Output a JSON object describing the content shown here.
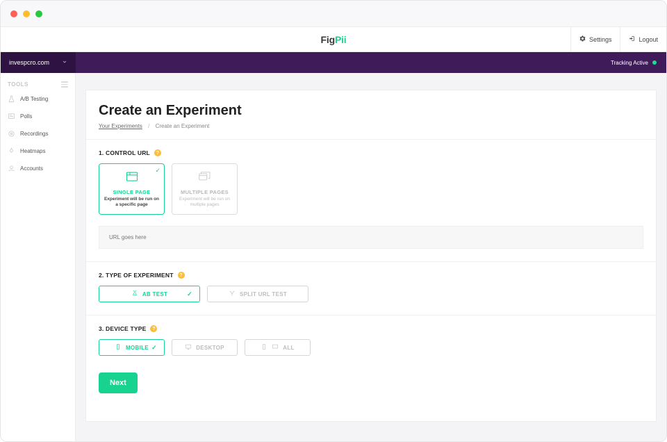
{
  "logo": {
    "part1": "Fig",
    "part2": "Pii"
  },
  "header": {
    "settings": "Settings",
    "logout": "Logout"
  },
  "subbar": {
    "project": "invespcro.com",
    "tracking": "Tracking Active"
  },
  "sidebar": {
    "heading": "TOOLS",
    "items": [
      {
        "label": "A/B Testing"
      },
      {
        "label": "Polls"
      },
      {
        "label": "Recordings"
      },
      {
        "label": "Heatmaps"
      },
      {
        "label": "Accounts"
      }
    ]
  },
  "page": {
    "title": "Create an Experiment",
    "breadcrumb_link": "Your Experiments",
    "breadcrumb_current": "Create an Experiment"
  },
  "step1": {
    "heading": "1. CONTROL URL",
    "single": {
      "title": "SINGLE PAGE",
      "desc": "Experiment will be run on a specific page"
    },
    "multi": {
      "title": "MULTIPLE PAGES",
      "desc": "Experiment will be run on multiple pages"
    },
    "url_placeholder": "URL goes here"
  },
  "step2": {
    "heading": "2. TYPE OF EXPERIMENT",
    "ab": "AB TEST",
    "split": "SPLIT URL TEST"
  },
  "step3": {
    "heading": "3. DEVICE TYPE",
    "mobile": "MOBILE",
    "desktop": "DESKTOP",
    "all": "ALL"
  },
  "next_label": "Next"
}
